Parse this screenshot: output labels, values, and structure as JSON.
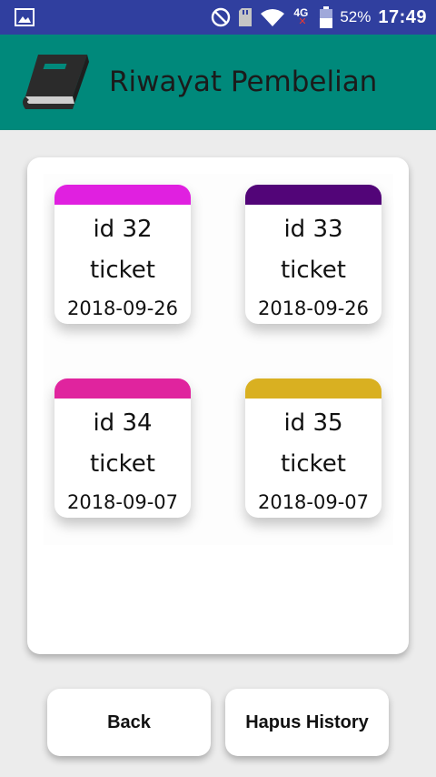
{
  "status_bar": {
    "battery_percent": "52%",
    "time": "17:49",
    "network_label": "4G",
    "icons": [
      "image-icon",
      "do-not-disturb-icon",
      "sd-card-icon",
      "wifi-icon",
      "network-4g-icon",
      "battery-icon"
    ]
  },
  "app_bar": {
    "title": "Riwayat Pembelian",
    "icon": "book-icon",
    "background": "#00897b"
  },
  "purchases": [
    {
      "id_label": "id 32",
      "type": "ticket",
      "date": "2018-09-26",
      "color": "#e020e0"
    },
    {
      "id_label": "id 33",
      "type": "ticket",
      "date": "2018-09-26",
      "color": "#520578"
    },
    {
      "id_label": "id 34",
      "type": "ticket",
      "date": "2018-09-07",
      "color": "#e0249e"
    },
    {
      "id_label": "id 35",
      "type": "ticket",
      "date": "2018-09-07",
      "color": "#d9b021"
    }
  ],
  "buttons": {
    "back": "Back",
    "clear_history": "Hapus History"
  }
}
